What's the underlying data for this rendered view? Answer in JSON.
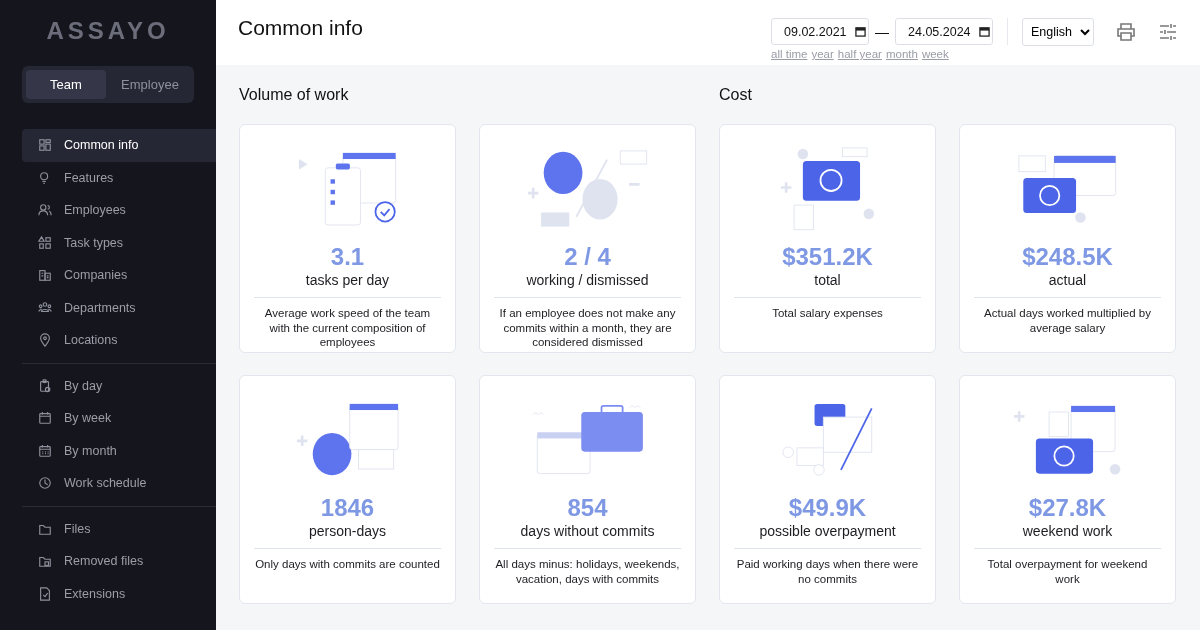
{
  "logo": "ASSAYO",
  "mode_switch": [
    {
      "label": "Team",
      "selected": true
    },
    {
      "label": "Employee",
      "selected": false
    }
  ],
  "sidebar": {
    "groups": [
      [
        {
          "label": "Common info",
          "selected": true
        },
        {
          "label": "Features",
          "selected": false
        },
        {
          "label": "Employees",
          "selected": false
        },
        {
          "label": "Task types",
          "selected": false
        },
        {
          "label": "Companies",
          "selected": false
        },
        {
          "label": "Departments",
          "selected": false
        },
        {
          "label": "Locations",
          "selected": false
        }
      ],
      [
        {
          "label": "By day",
          "selected": false
        },
        {
          "label": "By week",
          "selected": false
        },
        {
          "label": "By month",
          "selected": false
        },
        {
          "label": "Work schedule",
          "selected": false
        }
      ],
      [
        {
          "label": "Files",
          "selected": false
        },
        {
          "label": "Removed files",
          "selected": false
        },
        {
          "label": "Extensions",
          "selected": false
        }
      ]
    ]
  },
  "header": {
    "title": "Common info",
    "date_from": "09.02.2021",
    "date_separator": "—",
    "date_to": "24.05.2024",
    "periods": [
      "all time",
      "year",
      "half year",
      "month",
      "week"
    ],
    "language": "English"
  },
  "sections": [
    {
      "title": "Volume of work",
      "cards": [
        {
          "value": "3.1",
          "label": "tasks per day",
          "description": "Average work speed of the team with the current composition of employees"
        },
        {
          "value": "2 / 4",
          "label": "working / dismissed",
          "description": "If an employee does not make any commits within a month, they are considered dismissed"
        },
        {
          "value": "1846",
          "label": "person-days",
          "description": "Only days with commits are counted"
        },
        {
          "value": "854",
          "label": "days without commits",
          "description": "All days minus: holidays, weekends, vacation, days with commits"
        }
      ]
    },
    {
      "title": "Cost",
      "cards": [
        {
          "value": "$351.2K",
          "label": "total",
          "description": "Total salary expenses"
        },
        {
          "value": "$248.5K",
          "label": "actual",
          "description": "Actual days worked multiplied by average salary"
        },
        {
          "value": "$49.9K",
          "label": "possible overpayment",
          "description": "Paid working days when there were no commits"
        },
        {
          "value": "$27.8K",
          "label": "weekend work",
          "description": "Total overpayment for weekend work"
        }
      ]
    }
  ]
}
